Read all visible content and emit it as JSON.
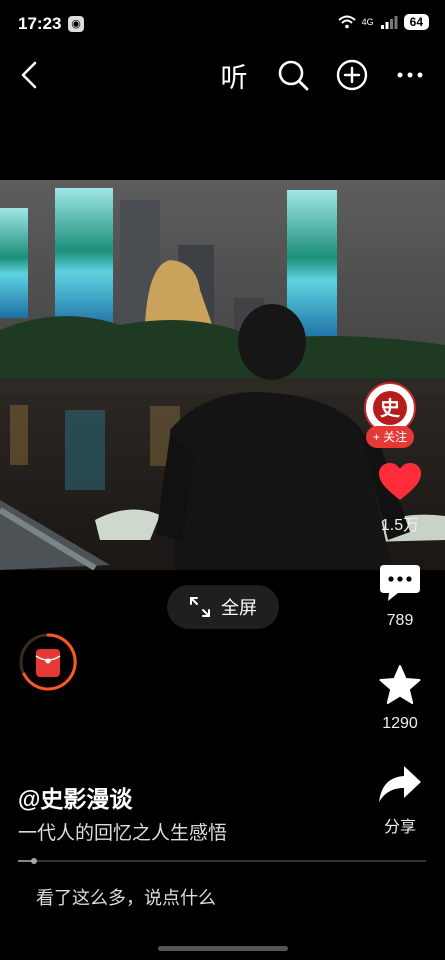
{
  "status": {
    "time": "17:23",
    "network": "4G",
    "battery": "64"
  },
  "nav": {
    "listen_label": "听"
  },
  "author": {
    "handle": "@史影漫谈",
    "avatar_char": "史",
    "follow_label": "+ 关注"
  },
  "video": {
    "description": "一代人的回忆之人生感悟",
    "fullscreen_label": "全屏",
    "progress": 0.04
  },
  "actions": {
    "likes": "1.5万",
    "comments": "789",
    "favorites": "1290",
    "share_label": "分享"
  },
  "comment_box": {
    "placeholder": "看了这么多，说点什么"
  },
  "colors": {
    "like": "#ff2d3a",
    "accent": "#e53935",
    "red_pack_ring": "#ff5722"
  }
}
